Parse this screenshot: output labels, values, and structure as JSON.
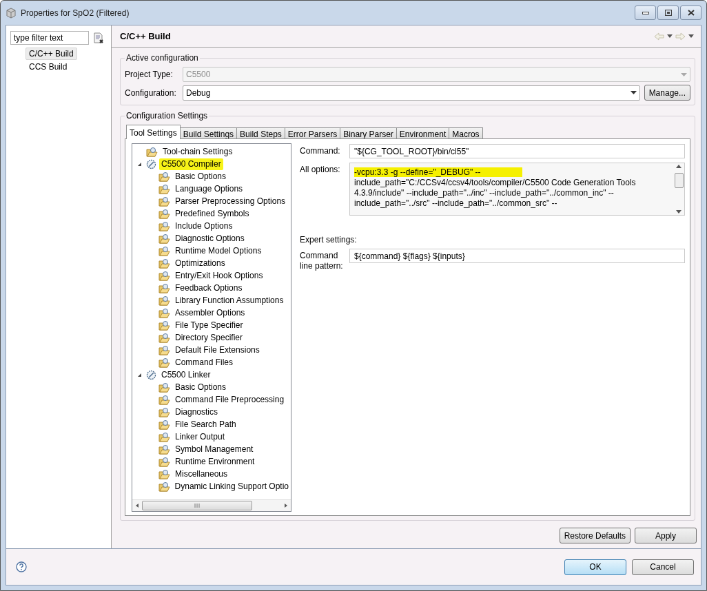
{
  "window": {
    "title": "Properties for SpO2 (Filtered)"
  },
  "sidebar": {
    "filter": {
      "placeholder": "type filter text"
    },
    "items": [
      {
        "label": "C/C++ Build",
        "selected": true
      },
      {
        "label": "CCS Build",
        "selected": false
      }
    ]
  },
  "page": {
    "title": "C/C++ Build"
  },
  "active_configuration": {
    "title": "Active configuration",
    "project_type": {
      "label": "Project Type:",
      "value": "C5500",
      "disabled": true
    },
    "configuration": {
      "label": "Configuration:",
      "value": "Debug",
      "disabled": false
    },
    "manage_button": "Manage..."
  },
  "configuration_settings": {
    "title": "Configuration Settings",
    "tabs": [
      {
        "label": "Tool Settings",
        "selected": true
      },
      {
        "label": "Build Settings",
        "selected": false
      },
      {
        "label": "Build Steps",
        "selected": false
      },
      {
        "label": "Error Parsers",
        "selected": false
      },
      {
        "label": "Binary Parser",
        "selected": false
      },
      {
        "label": "Environment",
        "selected": false
      },
      {
        "label": "Macros",
        "selected": false
      }
    ],
    "tree": [
      {
        "label": "Tool-chain Settings",
        "kind": "folder",
        "selected": false
      },
      {
        "label": "C5500 Compiler",
        "kind": "tool",
        "expanded": true,
        "selected": true,
        "children": [
          {
            "label": "Basic Options",
            "selected": false
          },
          {
            "label": "Language Options",
            "selected": false
          },
          {
            "label": "Parser Preprocessing Options",
            "selected": false
          },
          {
            "label": "Predefined Symbols",
            "selected": false
          },
          {
            "label": "Include Options",
            "selected": false
          },
          {
            "label": "Diagnostic Options",
            "selected": false
          },
          {
            "label": "Runtime Model Options",
            "selected": false
          },
          {
            "label": "Optimizations",
            "selected": false
          },
          {
            "label": "Entry/Exit Hook Options",
            "selected": false
          },
          {
            "label": "Feedback Options",
            "selected": false
          },
          {
            "label": "Library Function Assumptions",
            "selected": false
          },
          {
            "label": "Assembler Options",
            "selected": false
          },
          {
            "label": "File Type Specifier",
            "selected": false
          },
          {
            "label": "Directory Specifier",
            "selected": false
          },
          {
            "label": "Default File Extensions",
            "selected": false
          },
          {
            "label": "Command Files",
            "selected": false
          }
        ]
      },
      {
        "label": "C5500 Linker",
        "kind": "tool",
        "expanded": true,
        "selected": false,
        "children": [
          {
            "label": "Basic Options",
            "selected": false
          },
          {
            "label": "Command File Preprocessing",
            "selected": false
          },
          {
            "label": "Diagnostics",
            "selected": false
          },
          {
            "label": "File Search Path",
            "selected": false
          },
          {
            "label": "Linker Output",
            "selected": false
          },
          {
            "label": "Symbol Management",
            "selected": false
          },
          {
            "label": "Runtime Environment",
            "selected": false
          },
          {
            "label": "Miscellaneous",
            "selected": false
          },
          {
            "label": "Dynamic Linking Support Optio",
            "selected": false
          }
        ]
      }
    ],
    "command": {
      "label": "Command:",
      "value": "\"${CG_TOOL_ROOT}/bin/cl55\""
    },
    "all_options": {
      "label": "All options:",
      "lines": [
        {
          "text": "-vcpu:3.3 -g --define=\"_DEBUG\" --",
          "highlighted": true
        },
        {
          "text": "include_path=\"C:/CCSv4/ccsv4/tools/compiler/C5500 Code Generation Tools",
          "highlighted": false
        },
        {
          "text": "4.3.9/include\" --include_path=\"../inc\" --include_path=\"../common_inc\" --",
          "highlighted": false
        },
        {
          "text": "include_path=\"../src\" --include_path=\"../common_src\" --",
          "highlighted": false
        }
      ]
    },
    "expert_settings": "Expert settings:",
    "command_line_pattern": {
      "label": "Command line pattern:",
      "value": "${command} ${flags} ${inputs}"
    }
  },
  "buttons": [
    "Restore Defaults",
    "Apply"
  ],
  "dialog_buttons": [
    {
      "label": "OK",
      "default": true
    },
    {
      "label": "Cancel",
      "default": false
    }
  ]
}
